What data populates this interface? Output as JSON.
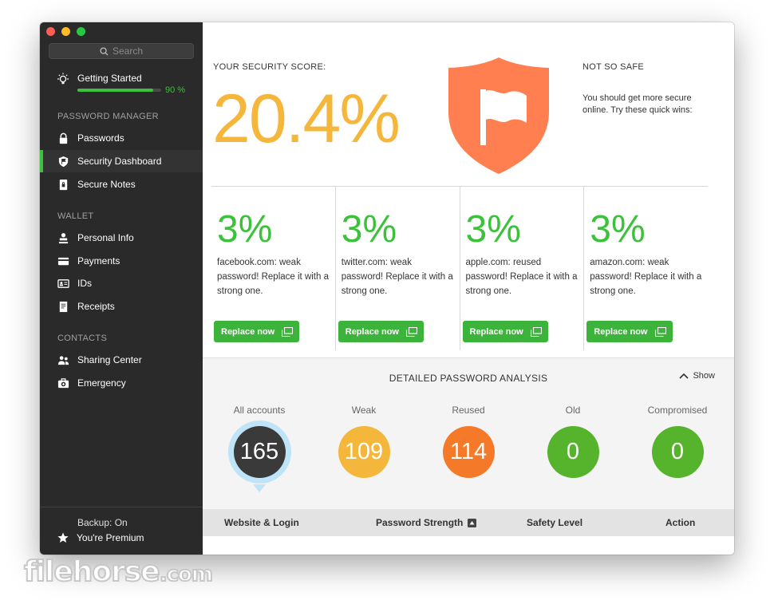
{
  "sidebar": {
    "search_placeholder": "Search",
    "getting_started": {
      "label": "Getting Started",
      "progress_pct": 90,
      "progress_text": "90 %"
    },
    "sections": [
      {
        "title": "PASSWORD MANAGER",
        "items": [
          {
            "label": "Passwords",
            "icon": "lock-icon"
          },
          {
            "label": "Security Dashboard",
            "icon": "shield-icon",
            "active": true
          },
          {
            "label": "Secure Notes",
            "icon": "note-icon"
          }
        ]
      },
      {
        "title": "WALLET",
        "items": [
          {
            "label": "Personal Info",
            "icon": "person-icon"
          },
          {
            "label": "Payments",
            "icon": "card-icon"
          },
          {
            "label": "IDs",
            "icon": "id-icon"
          },
          {
            "label": "Receipts",
            "icon": "receipt-icon"
          }
        ]
      },
      {
        "title": "CONTACTS",
        "items": [
          {
            "label": "Sharing Center",
            "icon": "people-icon"
          },
          {
            "label": "Emergency",
            "icon": "first-aid-icon"
          }
        ]
      }
    ],
    "backup": "Backup: On",
    "premium": "You're Premium"
  },
  "score": {
    "label": "YOUR SECURITY SCORE:",
    "value": "20.4%",
    "status_title": "NOT SO SAFE",
    "status_desc": "You should get more secure online. Try these quick wins:"
  },
  "quick_wins": [
    {
      "pct": "3%",
      "message": "facebook.com: weak password! Replace it with a strong one.",
      "button": "Replace now"
    },
    {
      "pct": "3%",
      "message": "twitter.com: weak password! Replace it with a strong one.",
      "button": "Replace now"
    },
    {
      "pct": "3%",
      "message": "apple.com: reused password! Replace it with a strong one.",
      "button": "Replace now"
    },
    {
      "pct": "3%",
      "message": "amazon.com: weak password! Replace it with a strong one.",
      "button": "Replace now"
    }
  ],
  "analysis": {
    "title": "DETAILED PASSWORD ANALYSIS",
    "toggle": "Show",
    "stats": [
      {
        "label": "All accounts",
        "value": "165",
        "color": "#3a3a3a",
        "selected": true
      },
      {
        "label": "Weak",
        "value": "109",
        "color": "#f4b73c"
      },
      {
        "label": "Reused",
        "value": "114",
        "color": "#f47a2a"
      },
      {
        "label": "Old",
        "value": "0",
        "color": "#55b32c"
      },
      {
        "label": "Compromised",
        "value": "0",
        "color": "#55b32c"
      }
    ]
  },
  "table": {
    "columns": [
      "Website & Login",
      "Password Strength",
      "Safety Level",
      "Action"
    ]
  },
  "colors": {
    "accent_green": "#3cc23a",
    "score_yellow": "#f4b73c",
    "shield_orange": "#ff7f50"
  },
  "watermark": {
    "main": "filehorse",
    "suffix": ".com"
  }
}
